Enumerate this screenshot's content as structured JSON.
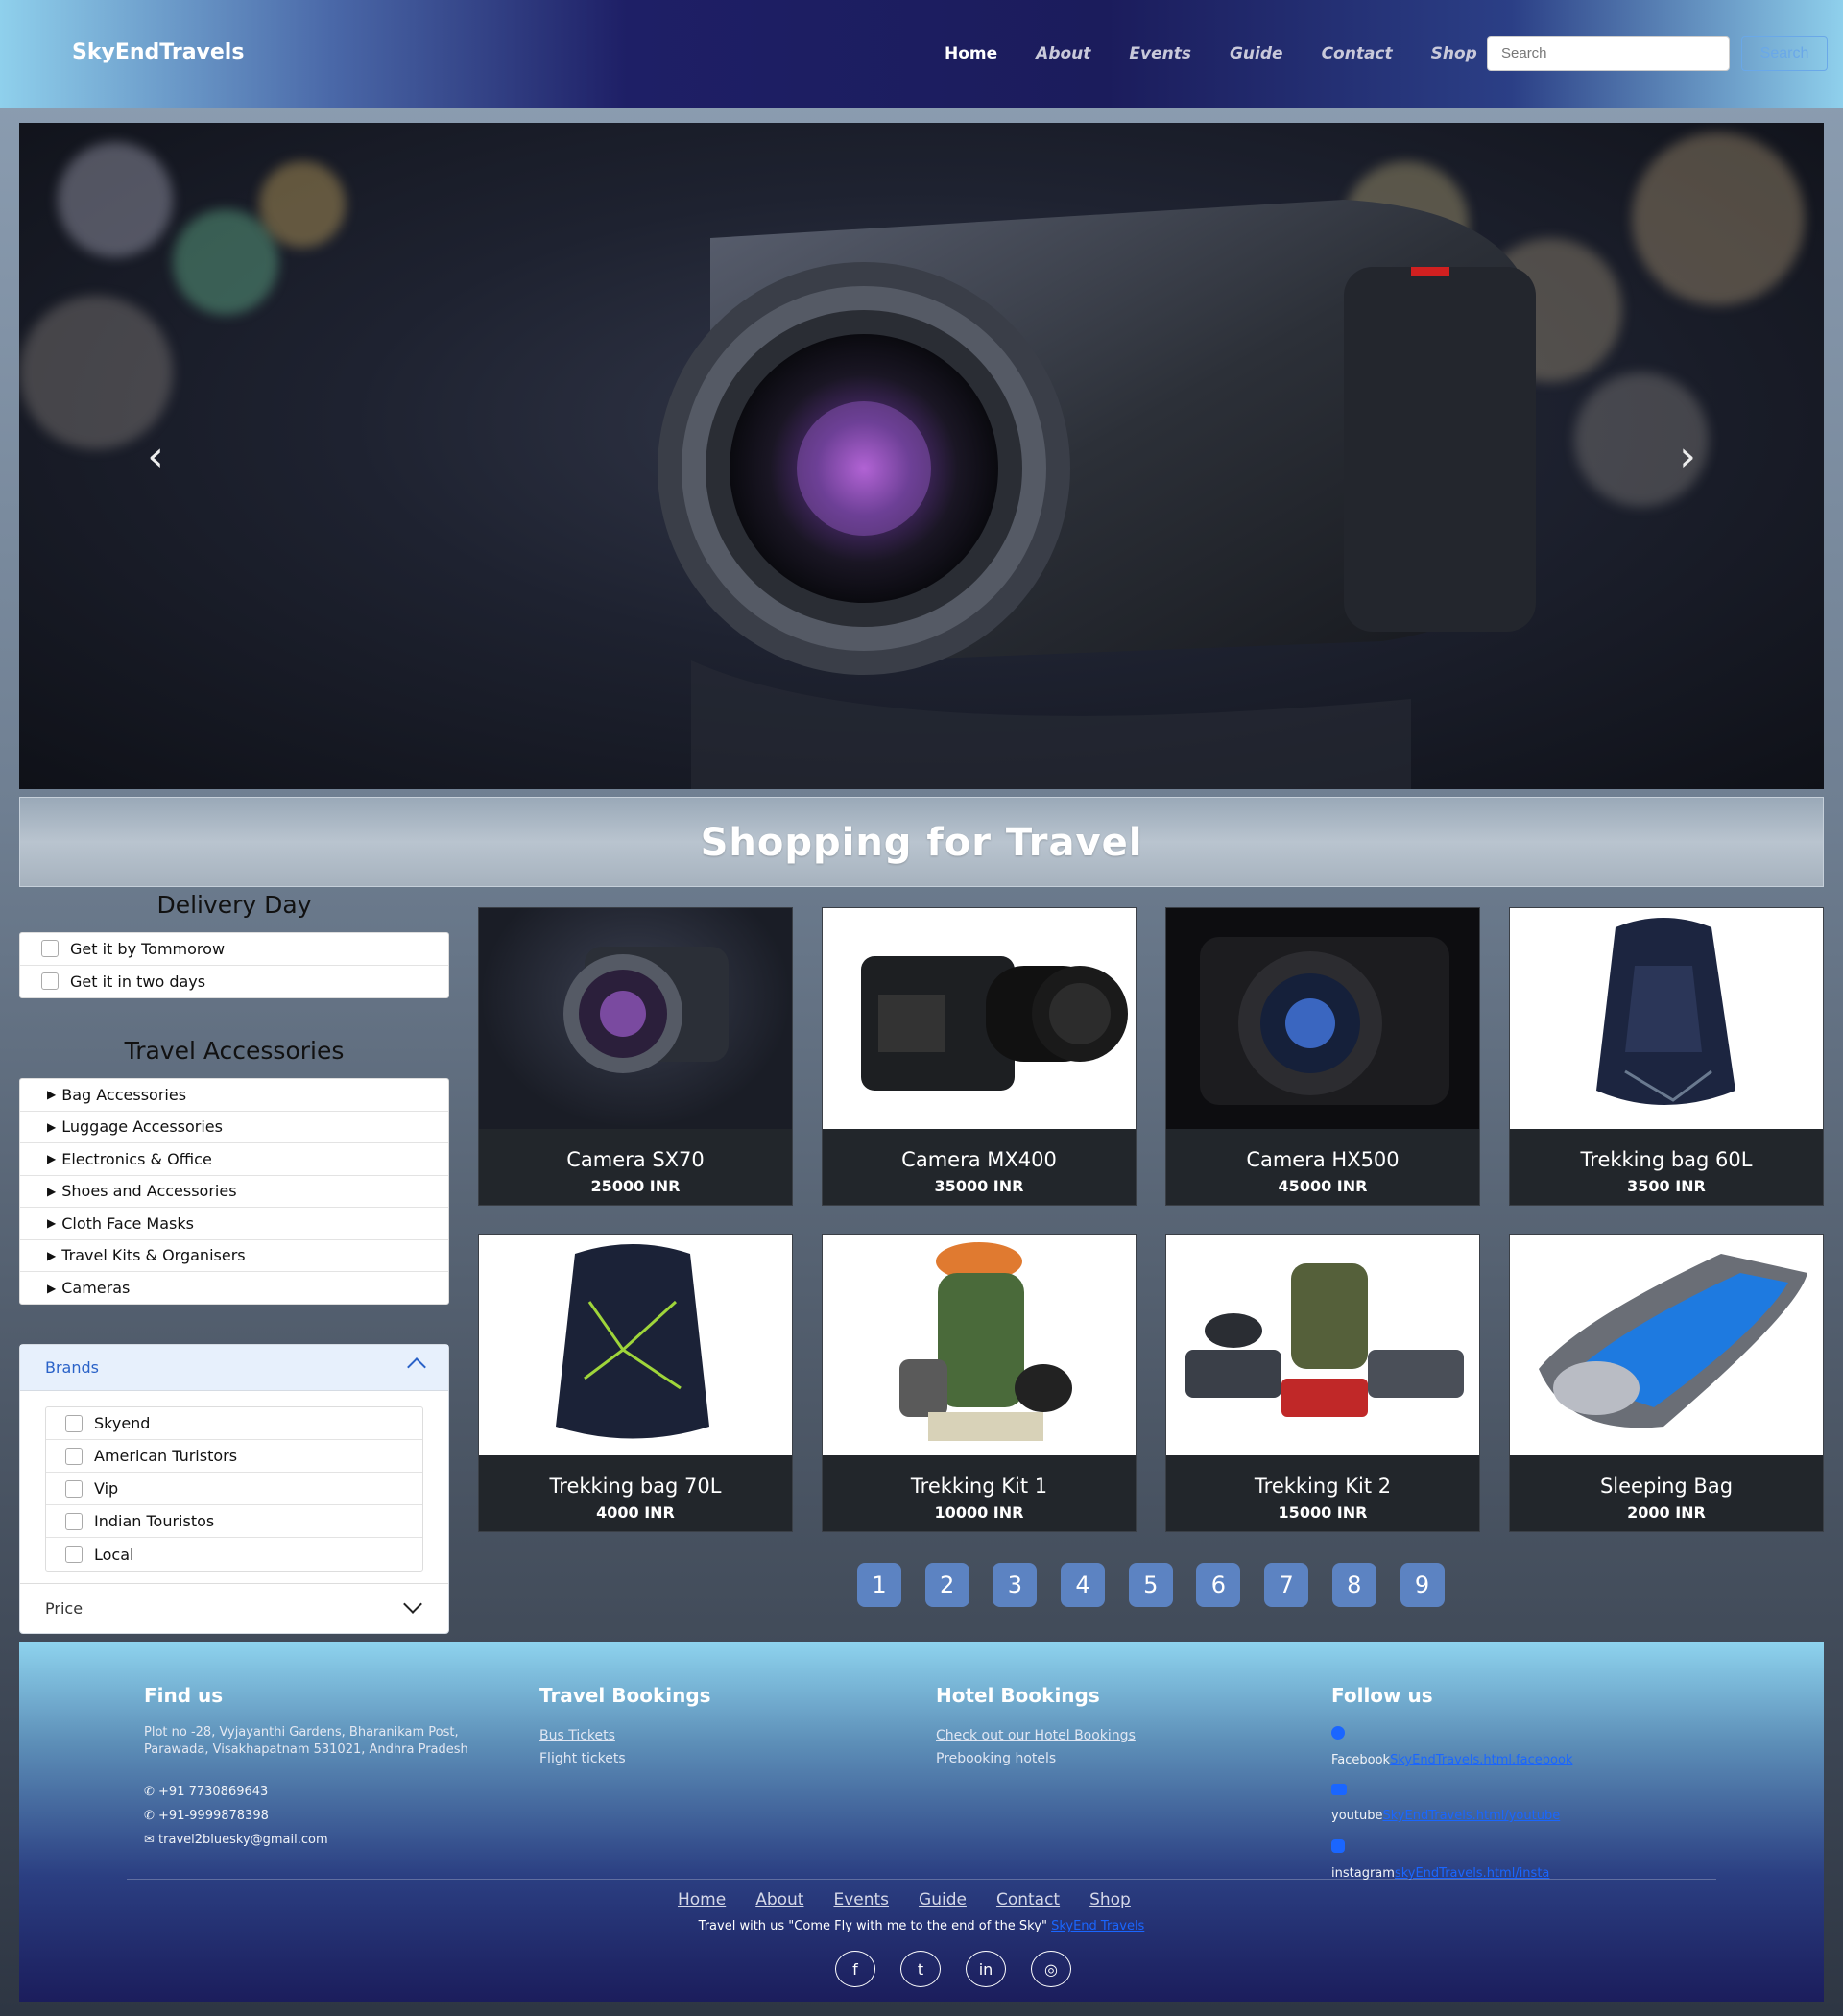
{
  "nav": {
    "brand": "SkyEndTravels",
    "links": [
      "Home",
      "About",
      "Events",
      "Guide",
      "Contact",
      "Shop"
    ],
    "active": "Home",
    "search_placeholder": "Search",
    "search_button": "Search"
  },
  "hero": {
    "prev_icon": "chevron-left-icon",
    "next_icon": "chevron-right-icon"
  },
  "section": {
    "title": "Shopping for Travel"
  },
  "sidebar": {
    "delivery_heading": "Delivery Day",
    "delivery_options": [
      "Get it by Tommorow",
      "Get it in two days"
    ],
    "accessories_heading": "Travel Accessories",
    "accessories": [
      "Bag Accessories",
      "Luggage Accessories",
      "Electronics & Office",
      " Shoes and Accessories",
      "Cloth Face Masks",
      "Travel Kits & Organisers",
      "Cameras"
    ],
    "brands_heading": "Brands",
    "brands": [
      "Skyend",
      "American Turistors",
      "Vip",
      "Indian Touristos",
      "Local"
    ],
    "price_heading": "Price"
  },
  "products": [
    {
      "name": "Camera SX70",
      "price": "25000 INR"
    },
    {
      "name": "Camera MX400",
      "price": "35000 INR"
    },
    {
      "name": "Camera HX500",
      "price": "45000 INR"
    },
    {
      "name": "Trekking bag 60L",
      "price": "3500 INR"
    },
    {
      "name": "Trekking bag 70L",
      "price": "4000 INR"
    },
    {
      "name": "Trekking Kit 1",
      "price": "10000 INR"
    },
    {
      "name": "Trekking Kit 2",
      "price": "15000 INR"
    },
    {
      "name": "Sleeping Bag",
      "price": "2000 INR"
    }
  ],
  "pagination": [
    "1",
    "2",
    "3",
    "4",
    "5",
    "6",
    "7",
    "8",
    "9"
  ],
  "footer": {
    "find_us": {
      "heading": "Find us",
      "address": "Plot no -28, Vyjayanthi Gardens, Bharanikam Post, Parawada, Visakhapatnam 531021, Andhra Pradesh",
      "phone1": "+91 7730869643",
      "phone2": "+91-9999878398",
      "email": "travel2bluesky@gmail.com"
    },
    "travel": {
      "heading": "Travel Bookings",
      "links": [
        "Bus Tickets",
        "Flight tickets"
      ]
    },
    "hotel": {
      "heading": "Hotel Bookings",
      "links": [
        "Check out our Hotel Bookings",
        "Prebooking hotels"
      ]
    },
    "follow": {
      "heading": "Follow us",
      "facebook_label": "Facebook",
      "facebook_link": "SkyEndTravels.html.facebook",
      "youtube_label": "youtube",
      "youtube_link": "SkyEndTravels.html/youtube",
      "instagram_label": "instagram",
      "instagram_link": "skyEndTravels.html/insta"
    },
    "bottom_links": [
      "Home ",
      "About ",
      "Events ",
      "Guide ",
      "Contact ",
      "Shop"
    ],
    "tagline": "Travel with us \"Come Fly with me to the end of the Sky\" ",
    "tagline_link": "SkyEnd Travels",
    "social_icons": [
      "facebook-icon",
      "twitter-icon",
      "linkedin-icon",
      "instagram-icon"
    ]
  },
  "colors": {
    "accent": "#5c83c2",
    "nav_dark": "#1e1f66",
    "link_blue": "#1a66ff"
  }
}
